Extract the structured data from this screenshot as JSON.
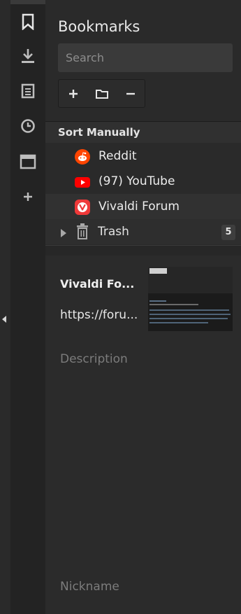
{
  "rail": {
    "items": [
      {
        "name": "bookmarks-icon",
        "active": true
      },
      {
        "name": "downloads-icon"
      },
      {
        "name": "notes-icon"
      },
      {
        "name": "history-icon"
      },
      {
        "name": "window-icon"
      },
      {
        "name": "add-panel-icon"
      }
    ]
  },
  "panel": {
    "title": "Bookmarks",
    "search_placeholder": "Search",
    "toolbar": {
      "add": "+",
      "folder": "folder",
      "remove": "−"
    }
  },
  "list": {
    "sort_label": "Sort Manually",
    "items": [
      {
        "label": "Reddit",
        "icon": "reddit-icon"
      },
      {
        "label": "(97) YouTube",
        "icon": "youtube-icon"
      },
      {
        "label": "Vivaldi Forum",
        "icon": "vivaldi-icon",
        "selected": true
      }
    ],
    "trash": {
      "label": "Trash",
      "count": "5"
    }
  },
  "details": {
    "title": "Vivaldi Fo...",
    "url": "https://foru...",
    "description_placeholder": "Description",
    "nickname_placeholder": "Nickname"
  },
  "colors": {
    "reddit": "#ff4500",
    "youtube": "#ff0000",
    "vivaldi": "#ef3939"
  }
}
